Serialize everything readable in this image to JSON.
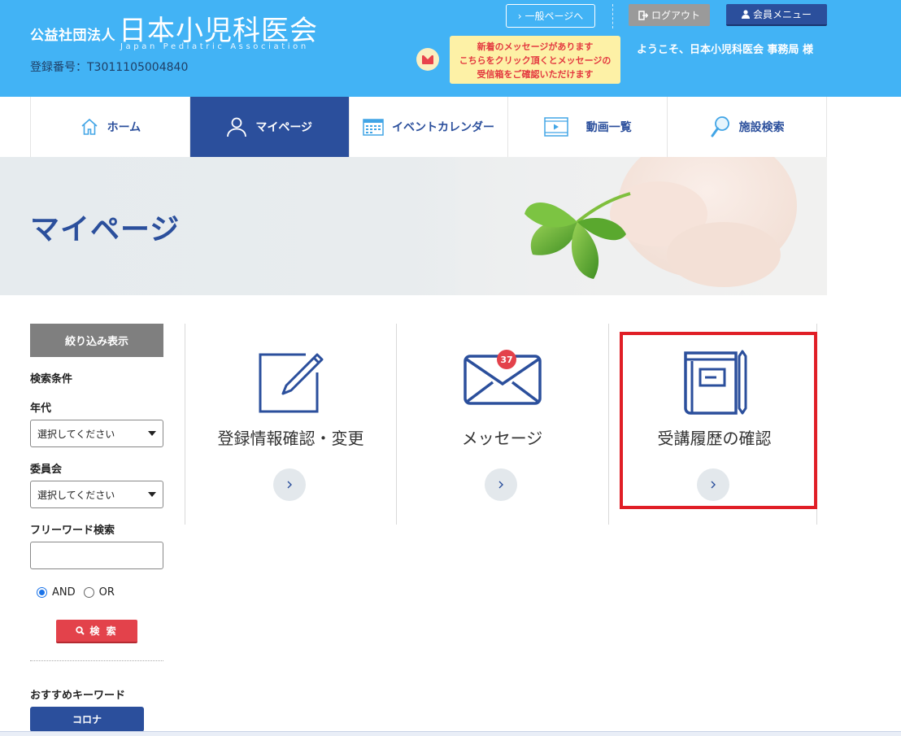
{
  "header": {
    "org_small": "公益社団法人",
    "org_name": "日本小児科医会",
    "org_en": "Japan Pediatric Association",
    "reg_no": "登録番号：T3011105004840",
    "general_page_label": "一般ページへ",
    "logout_label": "ログアウト",
    "member_menu_label": "会員メニュー",
    "notice_lines": [
      "新着のメッセージがあります",
      "こちらをクリック頂くとメッセージの",
      "受信箱をご確認いただけます"
    ],
    "welcome": "ようこそ、日本小児科医会 事務局 様",
    "colors": {
      "bg": "#42b3f5",
      "accent": "#2b4f9c",
      "alert": "#e3383f"
    }
  },
  "nav": {
    "items": [
      {
        "label": "ホーム",
        "icon": "home-icon",
        "active": false
      },
      {
        "label": "マイページ",
        "icon": "user-icon",
        "active": true
      },
      {
        "label": "イベントカレンダー",
        "icon": "calendar-icon",
        "active": false
      },
      {
        "label": "動画一覧",
        "icon": "video-icon",
        "active": false
      },
      {
        "label": "施設検索",
        "icon": "magnifier-icon",
        "active": false
      }
    ]
  },
  "hero": {
    "title": "マイページ"
  },
  "sidebar": {
    "heading": "絞り込み表示",
    "conditions_label": "検索条件",
    "age_label": "年代",
    "age_value": "選択してください",
    "committee_label": "委員会",
    "committee_value": "選択してください",
    "freeword_label": "フリーワード検索",
    "freeword_value": "",
    "radio_and": "AND",
    "radio_or": "OR",
    "radio_selected": "AND",
    "search_button": "検 索",
    "keywords_label": "おすすめキーワード",
    "keyword_tag": "コロナ"
  },
  "cards": [
    {
      "label": "登録情報確認・変更",
      "icon": "edit-icon"
    },
    {
      "label": "メッセージ",
      "icon": "envelope-icon",
      "badge": "37"
    },
    {
      "label": "受講履歴の確認",
      "icon": "notebook-icon",
      "highlighted": true
    }
  ]
}
